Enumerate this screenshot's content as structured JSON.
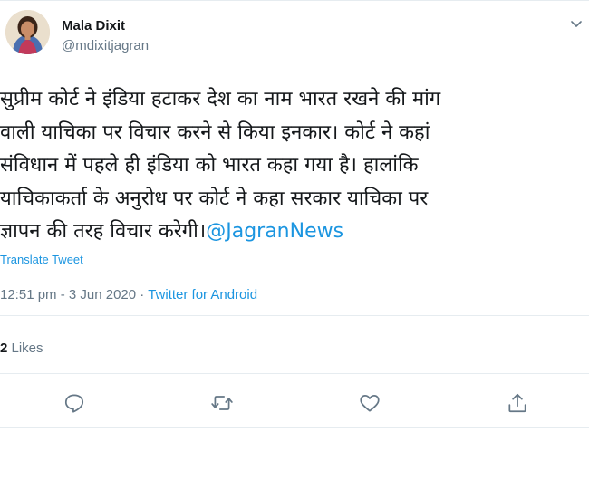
{
  "author": {
    "name": "Mala Dixit",
    "handle": "@mdixitjagran"
  },
  "tweet": {
    "text": "सुप्रीम कोर्ट ने इंडिया हटाकर देश का नाम भारत रखने की मांग\nवाली याचिका पर विचार करने से किया इनकार। कोर्ट ने कहां\nसंविधान में पहले ही इंडिया को भारत कहा गया है। हालांकि\nयाचिकाकर्ता के अनुरोध पर कोर्ट ने कहा सरकार याचिका पर\nज्ञापन की तरह विचार करेगी।",
    "mention": "@JagranNews"
  },
  "translate_label": "Translate Tweet",
  "meta": {
    "time": "12:51 pm",
    "separator1": " - ",
    "date": "3 Jun 2020",
    "separator2": " · ",
    "source": "Twitter for Android"
  },
  "stats": {
    "likes_count": "2",
    "likes_label": " Likes"
  },
  "icons": {
    "reply": "reply-icon",
    "retweet": "retweet-icon",
    "like": "heart-icon",
    "share": "share-icon",
    "more": "chevron-down-icon"
  },
  "colors": {
    "link": "#1b95e0",
    "secondary": "#657786",
    "divider": "#e6ecf0"
  }
}
